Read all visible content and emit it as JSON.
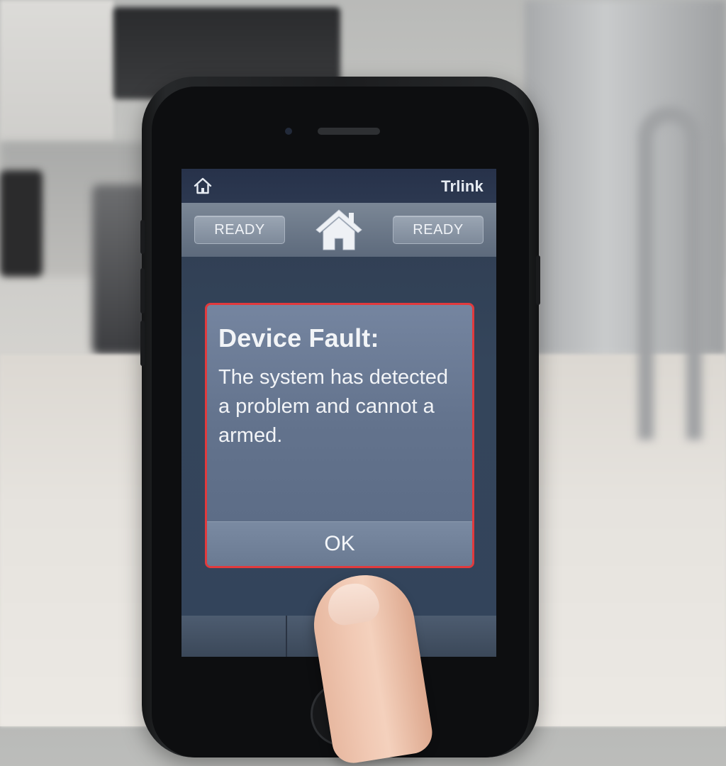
{
  "status_bar": {
    "home_icon": "home-outline-icon",
    "brand": "Trlink"
  },
  "toolbar": {
    "left_status": "READY",
    "center_icon": "house-icon",
    "right_status": "READY"
  },
  "dialog": {
    "title": "Device Fault:",
    "message": "The system has detected\na problem and cannot a\narmed.",
    "ok_label": "OK",
    "border_color": "#e23a3d"
  },
  "bottom_tabs": {
    "count_visible": 3
  }
}
